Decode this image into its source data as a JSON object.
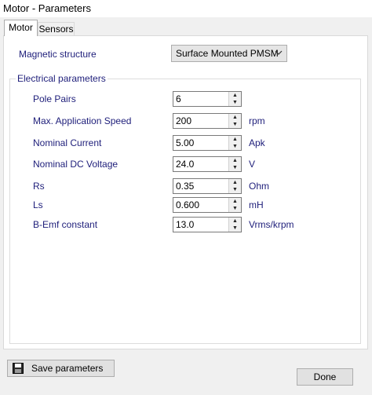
{
  "window": {
    "title": "Motor - Parameters"
  },
  "tabs": [
    {
      "label": "Motor",
      "active": true
    },
    {
      "label": "Sensors",
      "active": false
    }
  ],
  "magnetic_structure": {
    "label": "Magnetic structure",
    "value": "Surface Mounted PMSM"
  },
  "electrical": {
    "group_title": "Electrical parameters",
    "params": [
      {
        "label": "Pole Pairs",
        "value": "6",
        "unit": ""
      },
      {
        "label": "Max. Application Speed",
        "value": "200",
        "unit": "rpm"
      },
      {
        "label": "Nominal Current",
        "value": "5.00",
        "unit": "Apk"
      },
      {
        "label": "Nominal DC Voltage",
        "value": "24.0",
        "unit": "V"
      },
      {
        "label": "Rs",
        "value": "0.35",
        "unit": "Ohm"
      },
      {
        "label": "Ls",
        "value": "0.600",
        "unit": "mH"
      },
      {
        "label": "B-Emf constant",
        "value": "13.0",
        "unit": "Vrms/krpm"
      }
    ]
  },
  "buttons": {
    "save": "Save parameters",
    "done": "Done"
  },
  "icons": {
    "save": "floppy-disk-icon",
    "dropdown": "chevron-down-icon",
    "spin_up": "spin-up-arrow-icon",
    "spin_down": "spin-down-arrow-icon"
  }
}
